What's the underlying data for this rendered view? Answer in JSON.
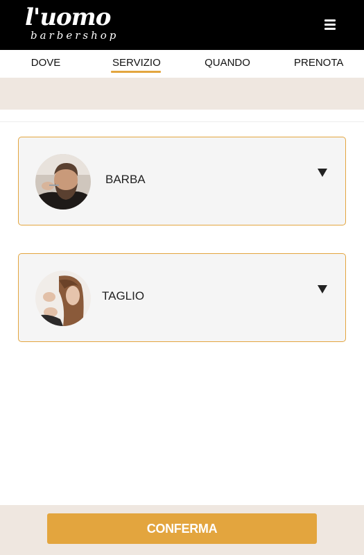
{
  "header": {
    "logo_main": "l'uomo",
    "logo_sub": "barbershop",
    "menu_icon": "hamburger-menu-icon"
  },
  "steps": [
    {
      "label": "DOVE",
      "active": false
    },
    {
      "label": "SERVIZIO",
      "active": true
    },
    {
      "label": "QUANDO",
      "active": false
    },
    {
      "label": "PRENOTA",
      "active": false
    }
  ],
  "services": [
    {
      "label": "BARBA",
      "icon": "chevron-down-icon"
    },
    {
      "label": "TAGLIO",
      "icon": "chevron-down-icon"
    }
  ],
  "footer": {
    "confirm_label": "CONFERMA"
  },
  "colors": {
    "accent": "#e3a53e",
    "header_bg": "#000000",
    "band_bg": "#efe7e0",
    "card_bg": "#f5f5f5"
  }
}
